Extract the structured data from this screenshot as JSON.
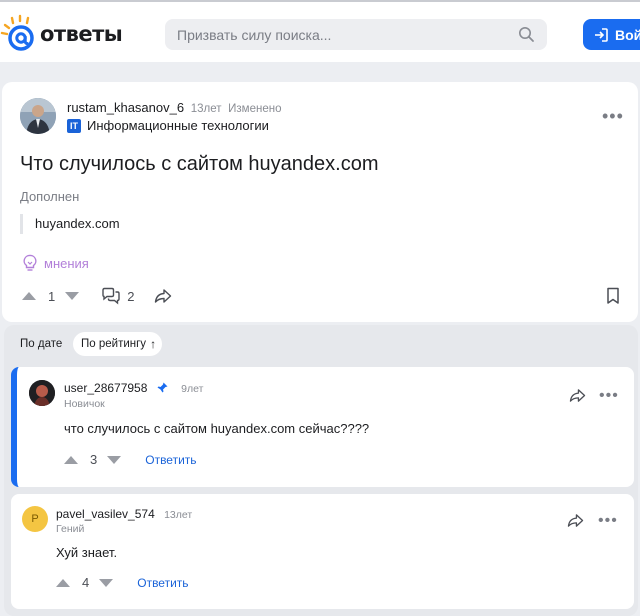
{
  "header": {
    "logo_text": "ответы",
    "search_placeholder": "Призвать силу поиска...",
    "login_label": "Вой"
  },
  "question": {
    "author": "rustam_khasanov_6",
    "time": "13лет",
    "edited": "Изменено",
    "category_badge": "IT",
    "category": "Информационные технологии",
    "title": "Что случилось с сайтом huyandex.com",
    "supplement_label": "Дополнен",
    "supplement_text": "huyandex.com",
    "opinions_label": "мнения",
    "votes": "1",
    "comments": "2"
  },
  "sorting": {
    "by_date": "По дате",
    "by_rating": "По рейтингу",
    "rating_arrow": "↑"
  },
  "answers": [
    {
      "author": "user_28677958",
      "time": "9лет",
      "rank": "Новичок",
      "text": "что случилось с сайтом huyandex.com сейчас????",
      "votes": "3",
      "reply": "Ответить"
    },
    {
      "author": "pavel_vasilev_574",
      "avatar_letter": "P",
      "time": "13лет",
      "rank": "Гений",
      "text": "Хуй знает.",
      "votes": "4",
      "reply": "Ответить"
    }
  ],
  "colors": {
    "accent": "#1a6cf0",
    "opinions": "#b27fd9",
    "reply_link": "#1a63d8",
    "avatar_yellow": "#f4c542"
  }
}
